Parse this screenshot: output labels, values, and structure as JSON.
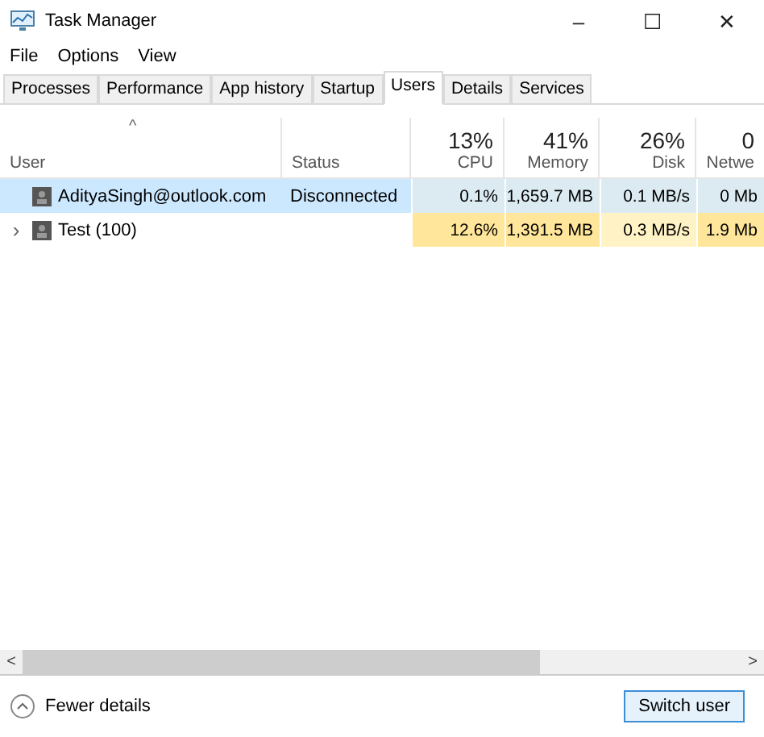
{
  "window": {
    "title": "Task Manager",
    "controls": [
      "–",
      "☐",
      "✕"
    ]
  },
  "menu": [
    "File",
    "Options",
    "View"
  ],
  "tabs": [
    {
      "label": "Processes",
      "selected": false
    },
    {
      "label": "Performance",
      "selected": false
    },
    {
      "label": "App history",
      "selected": false
    },
    {
      "label": "Startup",
      "selected": false
    },
    {
      "label": "Users",
      "selected": true
    },
    {
      "label": "Details",
      "selected": false
    },
    {
      "label": "Services",
      "selected": false
    }
  ],
  "table": {
    "sort_mark": "^",
    "columns": [
      {
        "label": "User"
      },
      {
        "label": "Status"
      },
      {
        "label": "CPU",
        "percent": "13%"
      },
      {
        "label": "Memory",
        "percent": "41%"
      },
      {
        "label": "Disk",
        "percent": "26%"
      },
      {
        "label": "Netwe",
        "percent": "0"
      }
    ],
    "rows": [
      {
        "selected": true,
        "user": "AdityaSingh@outlook.com",
        "status": "Disconnected",
        "metrics": [
          {
            "value": "0.1%",
            "color": "#dcebf2"
          },
          {
            "value": "1,659.7 MB",
            "color": "#dcebf2"
          },
          {
            "value": "0.1 MB/s",
            "color": "#dcebf2"
          },
          {
            "value": "0 Mb",
            "color": "#dcebf2"
          }
        ]
      },
      {
        "selected": false,
        "toggle": "›",
        "user": "Test (100)",
        "metrics": [
          {
            "value": "12.6%",
            "color": "#ffe69a"
          },
          {
            "value": "1,391.5 MB",
            "color": "#ffe69a"
          },
          {
            "value": "0.3 MB/s",
            "color": "#fff3c6"
          },
          {
            "value": "1.9 Mb",
            "color": "#ffe69a"
          }
        ]
      }
    ]
  },
  "scrollbar": {
    "left": "<",
    "right": ">",
    "level": 0.72
  },
  "footer": {
    "fewer_details": "Fewer details",
    "switch_user": "Switch user"
  }
}
